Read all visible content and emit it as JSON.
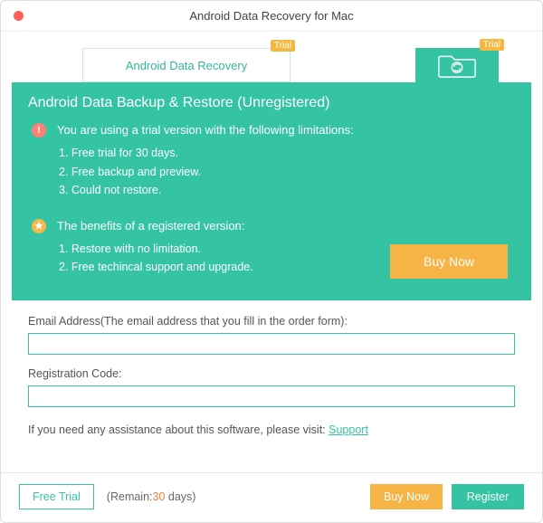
{
  "window": {
    "title": "Android Data Recovery for Mac"
  },
  "tabs": {
    "data_recovery": {
      "label": "Android Data Recovery",
      "badge": "Trial"
    },
    "backup_restore": {
      "badge": "Trial"
    }
  },
  "panel": {
    "heading": "Android Data Backup & Restore (Unregistered)",
    "trial_block": {
      "head": "You are using a trial version with the following limitations:",
      "items": [
        "1. Free trial for 30 days.",
        "2. Free backup and preview.",
        "3. Could not restore."
      ]
    },
    "benefits_block": {
      "head": "The benefits of a registered version:",
      "items": [
        "1. Restore with no limitation.",
        "2. Free techincal support and upgrade."
      ]
    },
    "buy_label": "Buy Now"
  },
  "form": {
    "email_label": "Email Address(The email address that you fill in the order form):",
    "code_label": "Registration Code:",
    "email_value": "",
    "code_value": "",
    "assist_text": "If you need any assistance about this software, please visit: ",
    "assist_link": "Support"
  },
  "footer": {
    "free_trial": "Free Trial",
    "remain_prefix": "(Remain:",
    "remain_days": "30",
    "remain_suffix": " days)",
    "buy": "Buy Now",
    "register": "Register"
  }
}
